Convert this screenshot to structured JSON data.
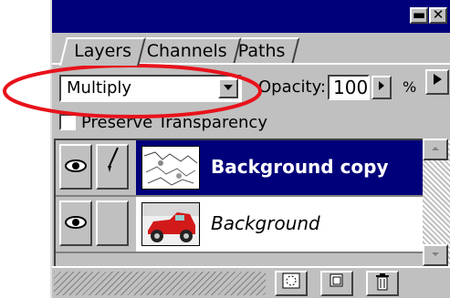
{
  "palette": {
    "tabs": [
      {
        "label": "Layers"
      },
      {
        "label": "Channels"
      },
      {
        "label": "Paths"
      }
    ],
    "title_buttons": {
      "minimize": "▬",
      "close": "✕"
    },
    "tab_scroll_icon": "triangle-right"
  },
  "controls": {
    "blend_mode": "Multiply",
    "opacity_label": "Opacity:",
    "opacity_value": "100",
    "opacity_unit": "%",
    "preserve_transparency_label": "Preserve Transparency",
    "preserve_transparency_checked": false
  },
  "layers": [
    {
      "name": "Background copy",
      "selected": true,
      "visible": true,
      "brush_active": true
    },
    {
      "name": "Background",
      "selected": false,
      "visible": true,
      "brush_active": false
    }
  ],
  "bottom_buttons": [
    {
      "icon": "layer-mask-icon"
    },
    {
      "icon": "new-layer-icon"
    },
    {
      "icon": "trash-icon"
    }
  ],
  "annotation": {
    "color": "#e8121b"
  }
}
